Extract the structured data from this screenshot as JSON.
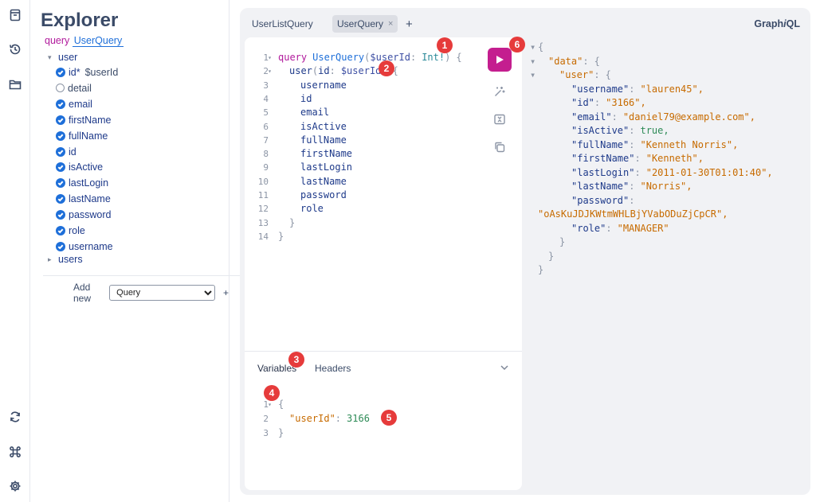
{
  "explorer": {
    "title": "Explorer",
    "operation_keyword": "query",
    "operation_name": "UserQuery",
    "tree": {
      "root": "user",
      "fields": [
        {
          "name": "id*",
          "arg": "$userId",
          "checked": true
        },
        {
          "name": "detail",
          "arg": "",
          "checked": false
        },
        {
          "name": "email",
          "arg": "",
          "checked": true
        },
        {
          "name": "firstName",
          "arg": "",
          "checked": true
        },
        {
          "name": "fullName",
          "arg": "",
          "checked": true
        },
        {
          "name": "id",
          "arg": "",
          "checked": true
        },
        {
          "name": "isActive",
          "arg": "",
          "checked": true
        },
        {
          "name": "lastLogin",
          "arg": "",
          "checked": true
        },
        {
          "name": "lastName",
          "arg": "",
          "checked": true
        },
        {
          "name": "password",
          "arg": "",
          "checked": true
        },
        {
          "name": "role",
          "arg": "",
          "checked": true
        },
        {
          "name": "username",
          "arg": "",
          "checked": true
        }
      ],
      "sibling": "users"
    },
    "add_new": {
      "label": "Add new",
      "selected": "Query",
      "plus": "+"
    }
  },
  "tabs": [
    {
      "label": "UserListQuery",
      "active": false
    },
    {
      "label": "UserQuery",
      "active": true,
      "close": "×"
    }
  ],
  "add_tab": "+",
  "brand": {
    "prefix": "Graph",
    "italic": "i",
    "suffix": "QL"
  },
  "editor": {
    "line_numbers": [
      "1",
      "2",
      "3",
      "4",
      "5",
      "6",
      "7",
      "8",
      "9",
      "10",
      "11",
      "12",
      "13",
      "14"
    ],
    "line1": {
      "kw": "query",
      "name": "UserQuery",
      "open": "(",
      "var": "$userId",
      "colon": ":",
      "type": "Int!",
      "close": ")",
      "brace": "{"
    },
    "line2": {
      "field": "user",
      "open": "(",
      "arg": "id",
      "colon": ":",
      "var": "$userId",
      "close": ")",
      "brace": "{"
    },
    "fields": [
      "username",
      "id",
      "email",
      "isActive",
      "fullName",
      "firstName",
      "lastLogin",
      "lastName",
      "password",
      "role"
    ],
    "close13": "}",
    "close14": "}"
  },
  "variables_pane": {
    "tabs": [
      "Variables",
      "Headers"
    ],
    "line_numbers": [
      "1",
      "2",
      "3"
    ],
    "open": "{",
    "key": "\"userId\"",
    "colon": ":",
    "value": "3166",
    "close": "}"
  },
  "response": {
    "open": "{",
    "data_key": "\"data\"",
    "user_key": "\"user\"",
    "entries": [
      {
        "key": "\"username\"",
        "value": "\"lauren45\","
      },
      {
        "key": "\"id\"",
        "value": "\"3166\","
      },
      {
        "key": "\"email\"",
        "value": "\"daniel79@example.com\","
      },
      {
        "key": "\"isActive\"",
        "value": "true,"
      },
      {
        "key": "\"fullName\"",
        "value": "\"Kenneth Norris\","
      },
      {
        "key": "\"firstName\"",
        "value": "\"Kenneth\","
      },
      {
        "key": "\"lastLogin\"",
        "value": "\"2011-01-30T01:01:40\","
      },
      {
        "key": "\"lastName\"",
        "value": "\"Norris\","
      },
      {
        "key": "\"password\"",
        "value": ""
      }
    ],
    "password_value": "\"oAsKuJDJKWtmWHLBjYVabODuZjCpCR\",",
    "role_key": "\"role\"",
    "role_value": "\"MANAGER\"",
    "close": "}"
  },
  "badges": [
    "1",
    "2",
    "3",
    "4",
    "5",
    "6"
  ],
  "colors": {
    "accent": "#c41e8f",
    "checkbox": "#1e6fd9",
    "badge": "#e63b3b",
    "panel_bg": "#f1f2f5"
  },
  "icons": [
    "docs-icon",
    "history-icon",
    "explorer-folder-icon",
    "refetch-schema-icon",
    "shortcuts-icon",
    "settings-icon",
    "run-icon",
    "prettify-icon",
    "merge-icon",
    "copy-icon"
  ]
}
